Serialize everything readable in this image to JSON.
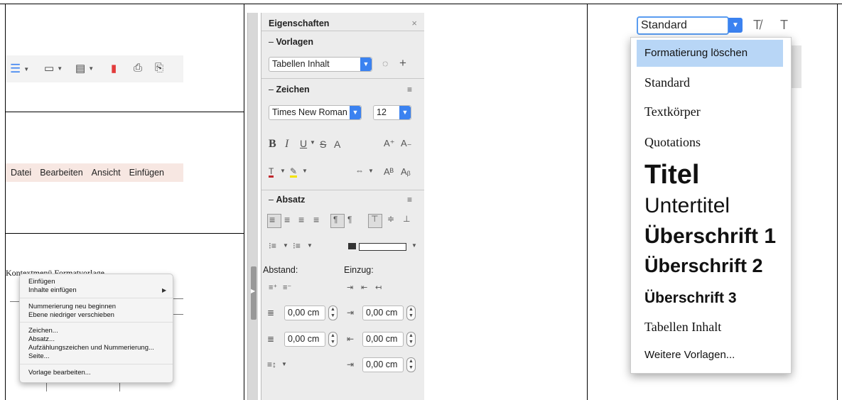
{
  "toolbar": {
    "icons": [
      "styles-icon",
      "folder-icon",
      "save-icon",
      "pdf-export-icon",
      "print-icon",
      "print-preview-icon"
    ]
  },
  "menubar": {
    "items": [
      "Datei",
      "Bearbeiten",
      "Ansicht",
      "Einfügen"
    ]
  },
  "context": {
    "doc_text": "Kontextmenü Formatvorlage",
    "menu": {
      "insert": "Einfügen",
      "paste_contents": "Inhalte einfügen",
      "restart_numbering": "Nummerierung neu beginnen",
      "demote": "Ebene niedriger verschieben",
      "character": "Zeichen...",
      "paragraph": "Absatz...",
      "bullets": "Aufzählungszeichen und Nummerierung...",
      "page": "Seite...",
      "edit_style": "Vorlage bearbeiten..."
    }
  },
  "sidebar": {
    "title": "Eigenschaften",
    "close": "×",
    "vorlagen": {
      "heading": "Vorlagen",
      "style_value": "Tabellen Inhalt"
    },
    "zeichen": {
      "heading": "Zeichen",
      "font": "Times New Roman",
      "size": "12"
    },
    "absatz": {
      "heading": "Absatz"
    },
    "abstand_label": "Abstand:",
    "einzug_label": "Einzug:",
    "spacing": [
      "0,00 cm",
      "0,00 cm"
    ],
    "indent": [
      "0,00 cm",
      "0,00 cm",
      "0,00 cm"
    ]
  },
  "styles_panel": {
    "current": "Standard",
    "items": {
      "clear": "Formatierung löschen",
      "standard": "Standard",
      "textbody": "Textkörper",
      "quotations": "Quotations",
      "title": "Titel",
      "subtitle": "Untertitel",
      "h1": "Überschrift 1",
      "h2": "Überschrift 2",
      "h3": "Überschrift 3",
      "table_contents": "Tabellen Inhalt",
      "more": "Weitere Vorlagen..."
    }
  },
  "colors": {
    "accent": "#3b82f0",
    "highlight": "#b8d6f6"
  }
}
